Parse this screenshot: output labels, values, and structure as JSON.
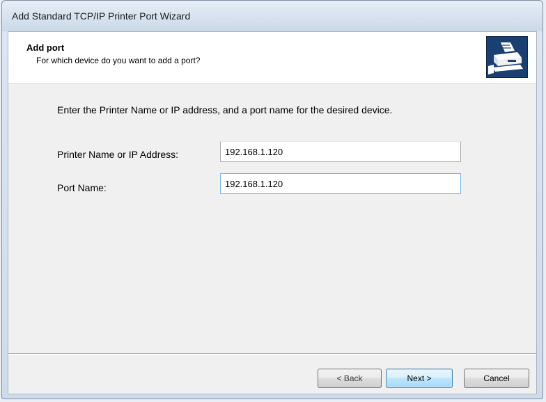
{
  "window": {
    "title": "Add Standard TCP/IP Printer Port Wizard"
  },
  "header": {
    "title": "Add port",
    "subtitle": "For which device do you want to add a port?",
    "icon": "printer-port-icon"
  },
  "content": {
    "instruction": "Enter the Printer Name or IP address, and a port name for the desired device.",
    "fields": [
      {
        "label": "Printer Name or IP Address:",
        "value": "192.168.1.120"
      },
      {
        "label": "Port Name:",
        "value": "192.168.1.120"
      }
    ]
  },
  "buttons": {
    "back": "< Back",
    "next": "Next >",
    "cancel": "Cancel"
  }
}
